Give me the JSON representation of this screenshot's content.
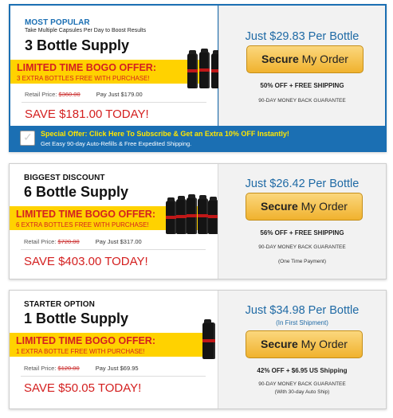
{
  "offers": [
    {
      "tag": "MOST POPULAR",
      "subtitle": "Take Multiple Capsules Per Day to Boost Results",
      "title": "3 Bottle Supply",
      "bogo_title": "LIMITED TIME BOGO OFFER:",
      "bogo_sub": "3 EXTRA BOTTLES FREE WITH PURCHASE!",
      "retail_label": "Retail Price:",
      "retail_value": "$360.00",
      "pay_just": "Pay Just $179.00",
      "save": "SAVE $181.00 TODAY!",
      "price_per_bottle": "Just $29.83 Per Bottle",
      "button_strong": "Secure",
      "button_rest": "My Order",
      "offer_line": "50% OFF + FREE SHIPPING",
      "guarantee": "90-DAY MONEY BACK GUARANTEE",
      "special_title": "Special Offer: Click Here To Subscribe & Get an Extra 10% OFF Instantly!",
      "special_sub": "Get Easy 90-day Auto-Refills & Free Expedited Shipping."
    },
    {
      "tag": "BIGGEST DISCOUNT",
      "title": "6 Bottle Supply",
      "bogo_title": "LIMITED TIME BOGO OFFER:",
      "bogo_sub": "6 EXTRA BOTTLES FREE WITH PURCHASE!",
      "retail_label": "Retail Price:",
      "retail_value": "$720.00",
      "pay_just": "Pay Just $317.00",
      "save": "SAVE $403.00 TODAY!",
      "price_per_bottle": "Just $26.42 Per Bottle",
      "button_strong": "Secure",
      "button_rest": "My Order",
      "offer_line": "56% OFF + FREE SHIPPING",
      "guarantee": "90-DAY MONEY BACK GUARANTEE",
      "payment_note": "(One Time Payment)"
    },
    {
      "tag": "STARTER OPTION",
      "title": "1 Bottle Supply",
      "bogo_title": "LIMITED TIME BOGO OFFER:",
      "bogo_sub": "1 EXTRA BOTTLE FREE WITH PURCHASE!",
      "retail_label": "Retail Price:",
      "retail_value": "$120.00",
      "pay_just": "Pay Just $69.95",
      "save": "SAVE $50.05 TODAY!",
      "price_per_bottle": "Just $34.98 Per Bottle",
      "price_note": "(In First Shipment)",
      "button_strong": "Secure",
      "button_rest": "My Order",
      "offer_line": "42% OFF + $6.95 US Shipping",
      "guarantee": "90-DAY MONEY BACK GUARANTEE",
      "guarantee_note": "(With 30-day Auto Ship)"
    }
  ],
  "colors": {
    "accent_blue": "#1b6fb3",
    "bogo_yellow": "#ffd200",
    "save_red": "#d42020",
    "button_gold": "#f0b22e"
  }
}
